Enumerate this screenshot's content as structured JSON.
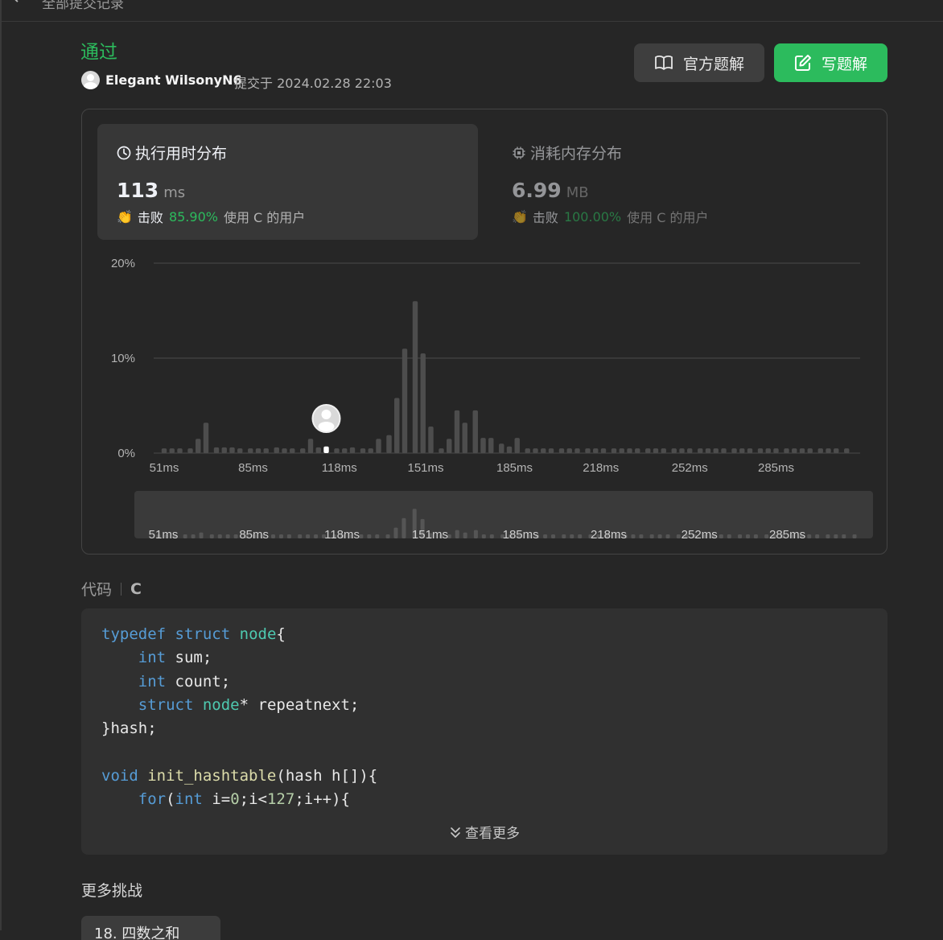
{
  "nav": {
    "back_label": "全部提交记录"
  },
  "submission": {
    "status": "通过",
    "username": "Elegant WilsonyN6",
    "submitted_at": "提交于 2024.02.28 22:03"
  },
  "actions": {
    "official_solution": "官方题解",
    "write_solution": "写题解"
  },
  "runtime": {
    "title": "执行用时分布",
    "value": "113",
    "unit": "ms",
    "beat_prefix": "击败",
    "beat_percent": "85.90%",
    "beat_suffix": "使用 C 的用户"
  },
  "memory": {
    "title": "消耗内存分布",
    "value": "6.99",
    "unit": "MB",
    "beat_prefix": "击败",
    "beat_percent": "100.00%",
    "beat_suffix": "使用 C 的用户"
  },
  "chart_data": {
    "type": "bar",
    "ylabel": "",
    "xlabel": "",
    "y_ticks": [
      "0%",
      "10%",
      "20%"
    ],
    "ylim": [
      0,
      20
    ],
    "x_tick_labels": [
      "51ms",
      "85ms",
      "118ms",
      "151ms",
      "185ms",
      "218ms",
      "252ms",
      "285ms"
    ],
    "x_range_ms": [
      51,
      315
    ],
    "bar_width_ms": 3.3,
    "highlight_x": 113,
    "series": [
      {
        "x": [
          51,
          54,
          57,
          61,
          64,
          67,
          71,
          74,
          77,
          80,
          84,
          87,
          90,
          94,
          97,
          100,
          104,
          107,
          110,
          113,
          117,
          120,
          123,
          127,
          130,
          133,
          137,
          140,
          143,
          147,
          150,
          153,
          157,
          160,
          163,
          166,
          170,
          173,
          176,
          180,
          183,
          186,
          190,
          193,
          196,
          199,
          203,
          206,
          209,
          213,
          216,
          219,
          223,
          226,
          229,
          232,
          236,
          239,
          242,
          246,
          249,
          252,
          256,
          259,
          262,
          265,
          269,
          272,
          275,
          279,
          282,
          285,
          289,
          292,
          295,
          298,
          302,
          305,
          308,
          312
        ],
        "values": [
          0.5,
          0.5,
          0.5,
          0.5,
          1.5,
          3.2,
          0.6,
          0.6,
          0.6,
          0.5,
          0.5,
          0.5,
          0.5,
          0.6,
          0.5,
          0.5,
          0.5,
          1.5,
          0.6,
          0.7,
          0.5,
          0.5,
          0.6,
          0.5,
          0.5,
          1.5,
          1.9,
          5.8,
          11,
          16,
          10.5,
          2.8,
          0.5,
          1.5,
          4.5,
          3.2,
          4.5,
          1.6,
          1.6,
          1.0,
          0.7,
          1.6,
          0.5,
          0.5,
          0.5,
          0.5,
          0.5,
          0.5,
          0.5,
          0.5,
          0.5,
          0.5,
          0.5,
          0.5,
          0.5,
          0.5,
          0.5,
          0.5,
          0.5,
          0.5,
          0.5,
          0.5,
          0.5,
          0.5,
          0.5,
          0.5,
          0.5,
          0.5,
          0.5,
          0.5,
          0.5,
          0.5,
          0.5,
          0.5,
          0.5,
          0.5,
          0.5,
          0.5,
          0.5,
          0.5
        ]
      }
    ],
    "grid": true,
    "colors": {
      "bar": "#4d4d4d",
      "highlight": "#ffffff",
      "grid": "#4a4a4a",
      "label": "#b3b3b3"
    }
  },
  "code": {
    "label": "代码",
    "language": "C",
    "lines": [
      "typedef struct node{",
      "    int sum;",
      "    int count;",
      "    struct node* repeatnext;",
      "}hash;",
      "",
      "void init_hashtable(hash h[]){",
      "    for(int i=0;i<127;i++){"
    ],
    "show_more": "查看更多"
  },
  "more_challenges": {
    "title": "更多挑战",
    "items": [
      "18. 四数之和"
    ]
  },
  "theme": {
    "accent": "#2cbb5d",
    "background": "#262626",
    "card": "#373737"
  }
}
